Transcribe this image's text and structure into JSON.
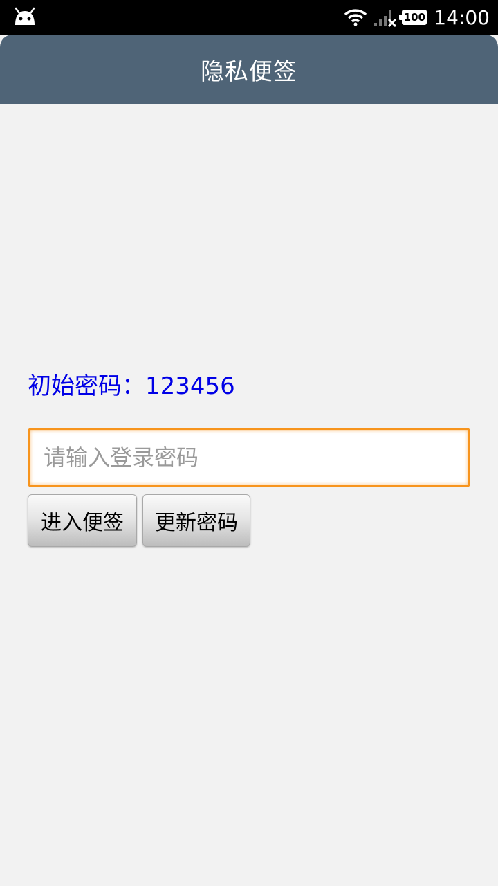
{
  "status_bar": {
    "time": "14:00",
    "battery": "100",
    "icons": [
      "android-icon",
      "wifi-icon",
      "signal-icon",
      "battery-icon"
    ]
  },
  "action_bar": {
    "title": "隐私便签"
  },
  "main": {
    "hint_text": "初始密码：123456",
    "password_input": {
      "value": "",
      "placeholder": "请输入登录密码"
    },
    "buttons": {
      "enter_label": "进入便签",
      "update_label": "更新密码"
    }
  },
  "colors": {
    "action_bar": "#4f6477",
    "hint": "#0000e6",
    "input_focus_border": "#f7941d",
    "background": "#f2f2f2"
  }
}
